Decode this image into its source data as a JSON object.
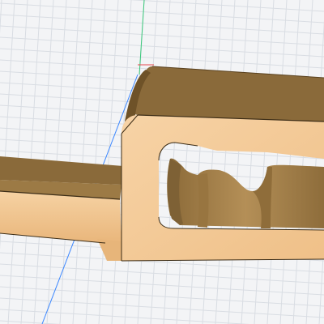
{
  "viewport": {
    "background": "#f3f4f6",
    "grid_color": "#d9dde3",
    "axis_green_color": "#39c87a",
    "axis_blue_color": "#3a86ff",
    "axis_red_color": "#e5484d"
  },
  "model": {
    "face_color": "#f2c58d",
    "face_shade_color": "#e8b77c",
    "top_color": "#8a6a3a",
    "side_dark_color": "#6e5228",
    "cavity_color": "#a8864e",
    "cavity_shadow_color": "#7e6135",
    "edge_color": "#3b2c16"
  }
}
